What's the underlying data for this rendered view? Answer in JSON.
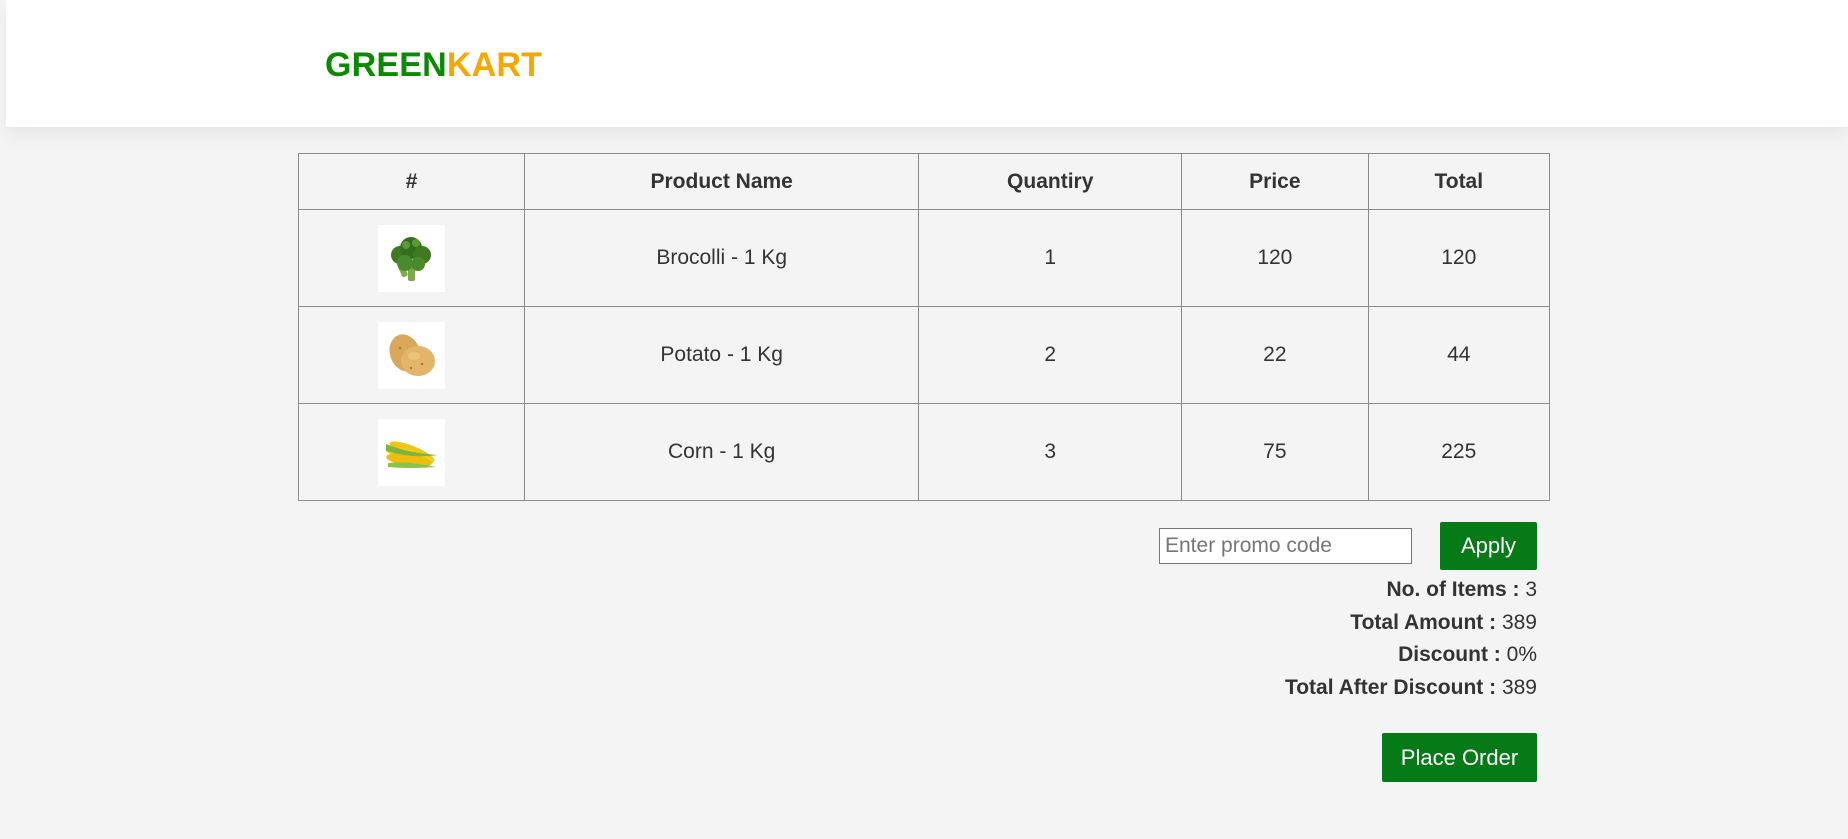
{
  "brand": {
    "part1": "GREEN",
    "part2": "KART",
    "color1": "#0b8a00",
    "color2": "#f7a800"
  },
  "table": {
    "headers": [
      "#",
      "Product Name",
      "Quantiry",
      "Price",
      "Total"
    ],
    "rows": [
      {
        "image": "broccoli-image",
        "name": "Brocolli - 1 Kg",
        "quantity": "1",
        "price": "120",
        "total": "120"
      },
      {
        "image": "potato-image",
        "name": "Potato - 1 Kg",
        "quantity": "2",
        "price": "22",
        "total": "44"
      },
      {
        "image": "corn-image",
        "name": "Corn - 1 Kg",
        "quantity": "3",
        "price": "75",
        "total": "225"
      }
    ]
  },
  "promo": {
    "placeholder": "Enter promo code",
    "value": "",
    "apply_label": "Apply"
  },
  "summary": {
    "items_label": "No. of Items :",
    "items_value": "3",
    "amount_label": "Total Amount :",
    "amount_value": "389",
    "discount_label": "Discount :",
    "discount_value": "0%",
    "after_label": "Total After Discount :",
    "after_value": "389"
  },
  "place_order_label": "Place Order",
  "accent_color": "#077a18"
}
